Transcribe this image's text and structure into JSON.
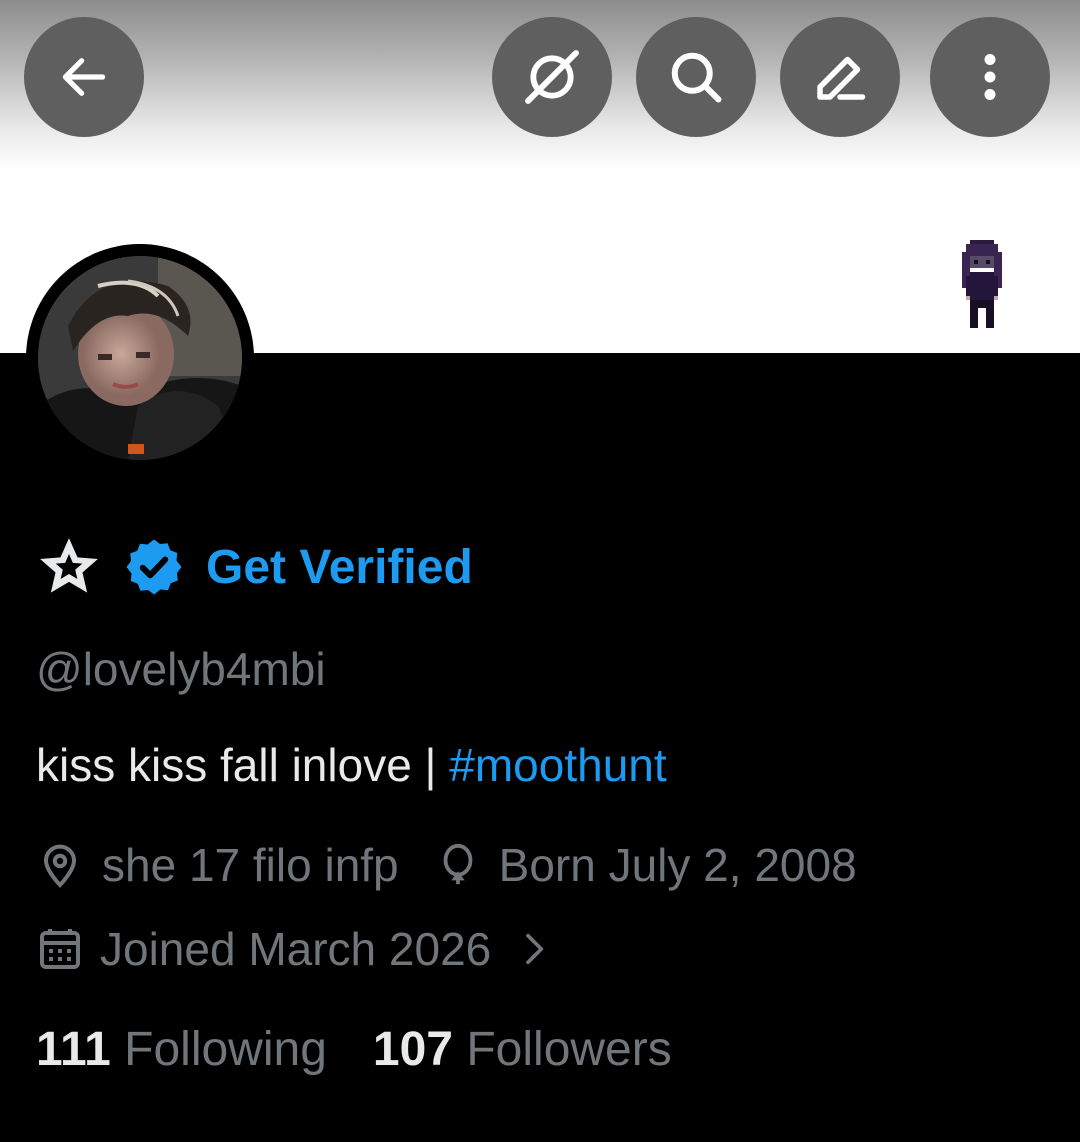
{
  "header": {
    "back_icon": "arrow-left-icon",
    "actions": [
      "grok-icon",
      "search-icon",
      "edit-icon",
      "more-icon"
    ]
  },
  "profile": {
    "verify_label": "Get Verified",
    "handle": "@lovelyb4mbi",
    "bio_text": "kiss kiss fall inlove | ",
    "bio_hashtag": "#moothunt",
    "location": "she 17 filo infp",
    "birthday": "Born July 2, 2008",
    "joined": "Joined March 2026",
    "following_count": "111",
    "following_label": "Following",
    "followers_count": "107",
    "followers_label": "Followers"
  },
  "colors": {
    "accent": "#1d9bf0",
    "muted_text": "#71767b",
    "primary_text": "#e7e9ea",
    "background": "#000000"
  }
}
